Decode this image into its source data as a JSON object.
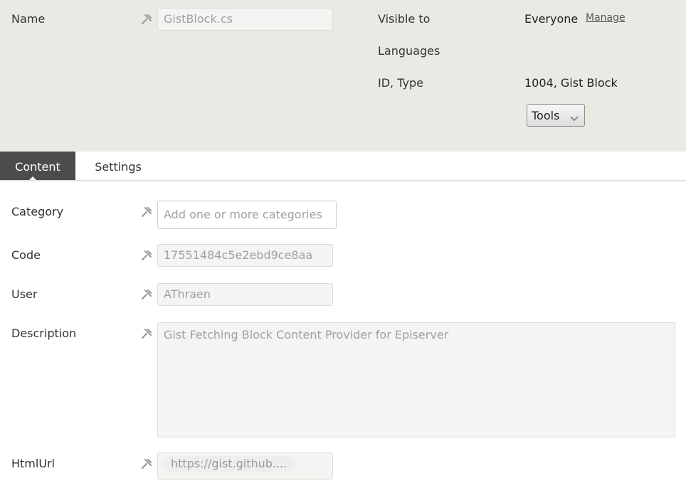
{
  "header": {
    "name_label": "Name",
    "name_value": "GistBlock.cs",
    "visible_to_label": "Visible to",
    "visible_to_value": "Everyone",
    "manage_link": "Manage",
    "languages_label": "Languages",
    "id_type_label": "ID, Type",
    "id_type_value": "1004, Gist Block",
    "tools_label": "Tools"
  },
  "tabs": [
    {
      "label": "Content",
      "active": true
    },
    {
      "label": "Settings",
      "active": false
    }
  ],
  "form": {
    "category": {
      "label": "Category",
      "placeholder": "Add one or more categories"
    },
    "code": {
      "label": "Code",
      "value": "17551484c5e2ebd9ce8aa"
    },
    "user": {
      "label": "User",
      "value": "AThraen"
    },
    "description": {
      "label": "Description",
      "value": "Gist Fetching Block Content Provider for Episerver"
    },
    "htmlurl": {
      "label": "HtmlUrl",
      "value": "https://gist.github...."
    }
  },
  "colors": {
    "header_bg": "#eaeae4",
    "active_tab_bg": "#4c4c4c",
    "field_bg": "#f4f4f2"
  },
  "icons": {
    "pin": "pin-icon",
    "chevron": "chevron-down-icon"
  }
}
